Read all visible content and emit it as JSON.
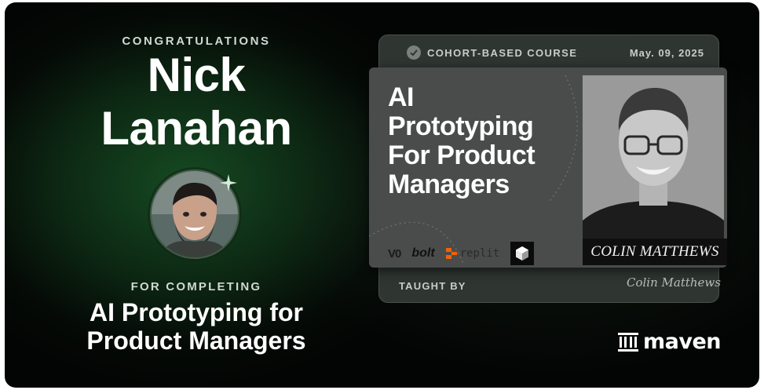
{
  "certificate": {
    "congrats_label": "CONGRATULATIONS",
    "recipient_first": "Nick",
    "recipient_last": "Lanahan",
    "for_completing_label": "FOR COMPLETING",
    "course_line1": "AI Prototyping for",
    "course_line2": "Product Managers"
  },
  "ticket": {
    "cohort_label": "COHORT-BASED COURSE",
    "date": "May. 09, 2025",
    "title_lines": [
      "AI",
      "Prototyping",
      "For Product",
      "Managers"
    ],
    "instructor_name": "COLIN MATTHEWS",
    "taught_by_label": "TAUGHT BY",
    "signature": "Colin Matthews",
    "tool_logos": {
      "v0": "V0",
      "bolt": "bolt",
      "replit": "replit"
    }
  },
  "brand": {
    "name": "maven"
  },
  "colors": {
    "background_dark": "#050a06",
    "glow_green": "#164a22",
    "ticket_gray": "#4a4c4b"
  }
}
